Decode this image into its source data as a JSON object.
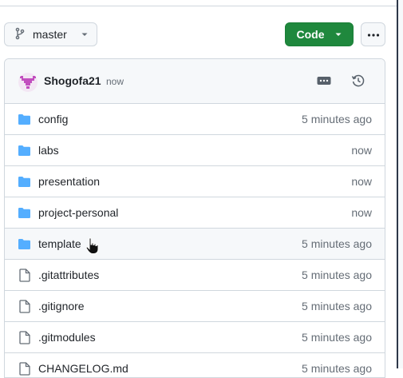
{
  "branch": {
    "name": "master",
    "icon": "git-branch-icon"
  },
  "toolbar": {
    "code_label": "Code",
    "more_icon": "kebab-horizontal-icon"
  },
  "commit": {
    "author": "Shogofa21",
    "time": "now"
  },
  "colors": {
    "folder": "#54aeff",
    "code_button": "#1f883d",
    "muted": "#656d76"
  },
  "files": [
    {
      "type": "folder",
      "name": "config",
      "age": "5 minutes ago"
    },
    {
      "type": "folder",
      "name": "labs",
      "age": "now"
    },
    {
      "type": "folder",
      "name": "presentation",
      "age": "now"
    },
    {
      "type": "folder",
      "name": "project-personal",
      "age": "now"
    },
    {
      "type": "folder",
      "name": "template",
      "age": "5 minutes ago"
    },
    {
      "type": "file",
      "name": ".gitattributes",
      "age": "5 minutes ago"
    },
    {
      "type": "file",
      "name": ".gitignore",
      "age": "5 minutes ago"
    },
    {
      "type": "file",
      "name": ".gitmodules",
      "age": "5 minutes ago"
    },
    {
      "type": "file",
      "name": "CHANGELOG.md",
      "age": "5 minutes ago"
    }
  ]
}
